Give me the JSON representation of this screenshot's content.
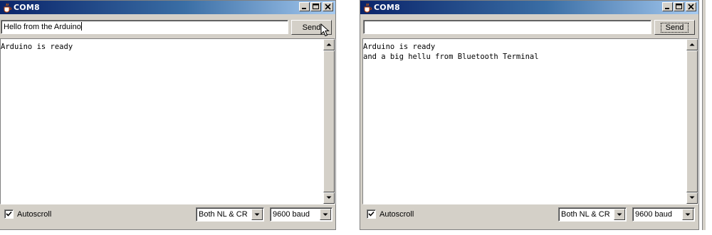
{
  "left_window": {
    "title": "COM8",
    "input_value": "Hello from the Arduino",
    "send_label": "Send",
    "output_lines": [
      "Arduino is ready"
    ],
    "autoscroll_label": "Autoscroll",
    "autoscroll_checked": true,
    "line_ending": "Both NL & CR",
    "baud_rate": "9600 baud"
  },
  "right_window": {
    "title": "COM8",
    "input_value": "",
    "send_label": "Send",
    "output_lines": [
      "Arduino is ready",
      "and a big hellu from Bluetooth Terminal"
    ],
    "autoscroll_label": "Autoscroll",
    "autoscroll_checked": true,
    "line_ending": "Both NL & CR",
    "baud_rate": "9600 baud"
  },
  "colors": {
    "titlebar_start": "#0a246a",
    "titlebar_end": "#a6caf0",
    "window_face": "#d4d0c8"
  },
  "icons": [
    "java-cup-icon",
    "minimize-icon",
    "maximize-icon",
    "close-icon",
    "scroll-up-icon",
    "scroll-down-icon",
    "checkmark-icon",
    "dropdown-arrow-icon",
    "mouse-cursor-icon"
  ]
}
